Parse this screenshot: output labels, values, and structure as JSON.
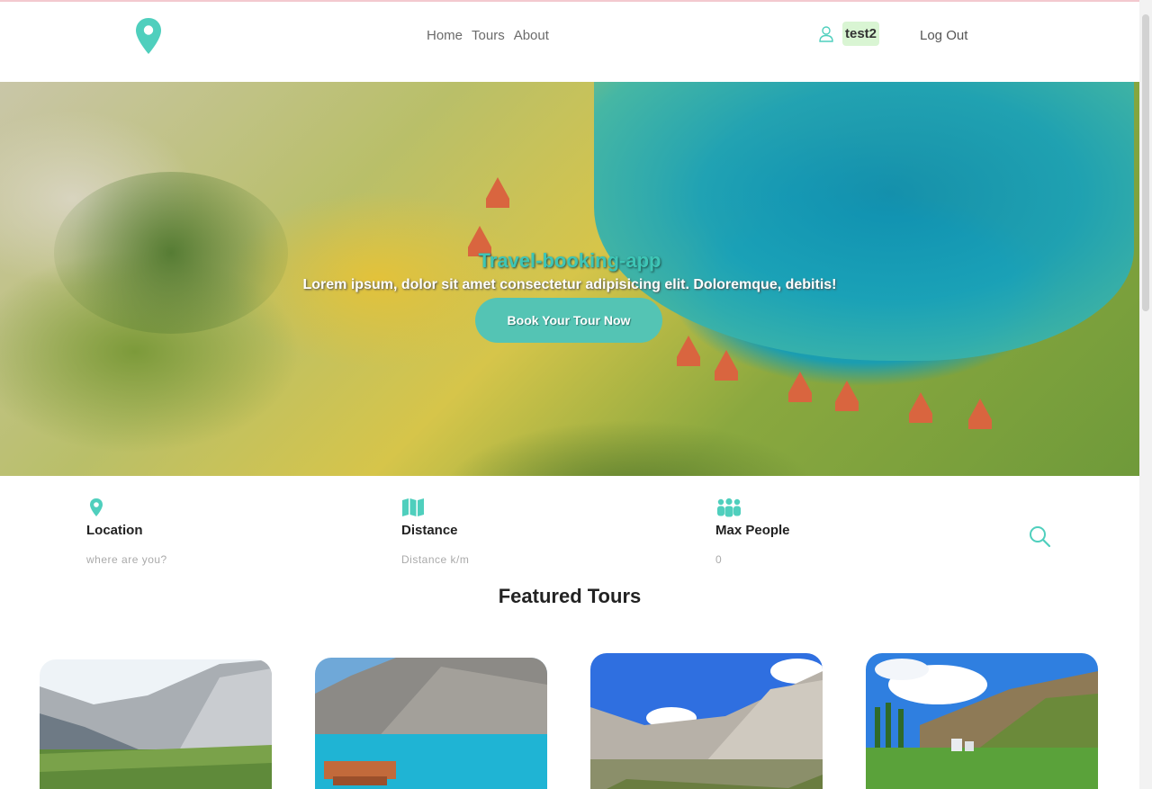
{
  "header": {
    "nav": {
      "home": "Home",
      "tours": "Tours",
      "about": "About"
    },
    "username": "test2",
    "logout": "Log Out"
  },
  "hero": {
    "title": "Travel-booking-app",
    "subtitle": "Lorem ipsum, dolor sit amet consectetur adipisicing elit. Doloremque, debitis!",
    "button": "Book Your Tour Now"
  },
  "search": {
    "location": {
      "label": "Location",
      "placeholder": "where are you?"
    },
    "distance": {
      "label": "Distance",
      "placeholder": "Distance k/m"
    },
    "people": {
      "label": "Max People",
      "placeholder": "0"
    }
  },
  "featured": {
    "title": "Featured Tours"
  },
  "colors": {
    "accent": "#4fcfbd",
    "userBadge": "#d9f5d3"
  }
}
